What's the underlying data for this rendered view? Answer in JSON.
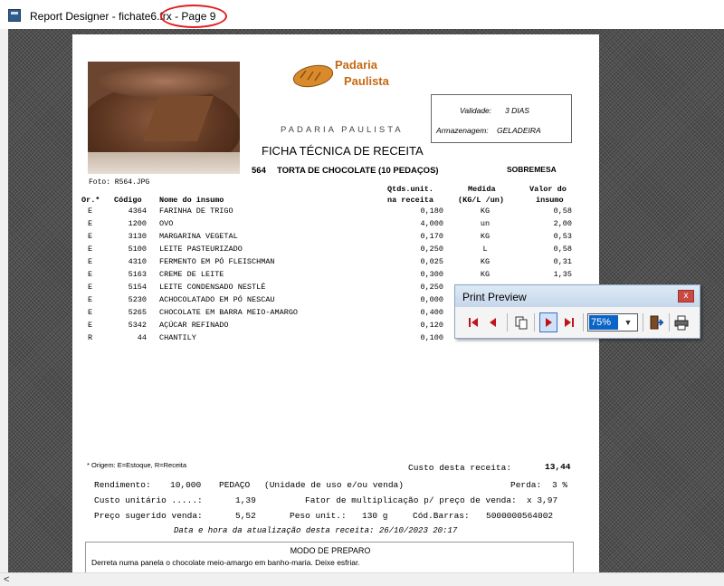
{
  "window": {
    "title": "Report Designer - fichate6.frx",
    "page_label": "- Page 9"
  },
  "report": {
    "header": {
      "logo_line1": "Padaria",
      "logo_line2": "Paulista",
      "subtitle": "PADARIA PAULISTA",
      "title": "FICHA TÉCNICA DE RECEITA",
      "photo_caption": "Foto: R564.JPG",
      "validade_label": "Validade:",
      "validade_value": "3 DIAS",
      "armazenagem_label": "Armazenagem:",
      "armazenagem_value": "GELADEIRA",
      "recipe_code": "564",
      "recipe_name": "TORTA DE CHOCOLATE (10 PEDAÇOS)",
      "category": "SOBREMESA"
    },
    "table": {
      "headers": {
        "or": "Or.*",
        "codigo": "Código",
        "nome": "Nome do insumo",
        "qtd_line1": "Qtds.unit.",
        "qtd_line2": "na receita",
        "medida_line1": "Medida",
        "medida_line2": "(KG/L /un)",
        "valor_line1": "Valor do",
        "valor_line2": "insumo"
      },
      "rows": [
        {
          "or": "E",
          "codigo": "4364",
          "nome": "FARINHA DE TRIGO",
          "qtd": "0,180",
          "medida": "KG",
          "valor": "0,58"
        },
        {
          "or": "E",
          "codigo": "1200",
          "nome": "OVO",
          "qtd": "4,000",
          "medida": "un",
          "valor": "2,00"
        },
        {
          "or": "E",
          "codigo": "3130",
          "nome": "MARGARINA VEGETAL",
          "qtd": "0,170",
          "medida": "KG",
          "valor": "0,53"
        },
        {
          "or": "E",
          "codigo": "5100",
          "nome": "LEITE PASTEURIZADO",
          "qtd": "0,250",
          "medida": "L",
          "valor": "0,58"
        },
        {
          "or": "E",
          "codigo": "4310",
          "nome": "FERMENTO EM PÓ FLEISCHMAN",
          "qtd": "0,025",
          "medida": "KG",
          "valor": "0,31"
        },
        {
          "or": "E",
          "codigo": "5163",
          "nome": "CREME DE LEITE",
          "qtd": "0,300",
          "medida": "KG",
          "valor": "1,35"
        },
        {
          "or": "E",
          "codigo": "5154",
          "nome": "LEITE CONDENSADO NESTLÉ",
          "qtd": "0,250",
          "medida": "",
          "valor": ""
        },
        {
          "or": "E",
          "codigo": "5230",
          "nome": "ACHOCOLATADO EM PÓ NESCAU",
          "qtd": "0,000",
          "medida": "",
          "valor": ""
        },
        {
          "or": "E",
          "codigo": "5265",
          "nome": "CHOCOLATE EM BARRA MEIO-AMARGO",
          "qtd": "0,400",
          "medida": "",
          "valor": ""
        },
        {
          "or": "E",
          "codigo": "5342",
          "nome": "AÇÚCAR REFINADO",
          "qtd": "0,120",
          "medida": "",
          "valor": ""
        },
        {
          "or": "R",
          "codigo": "44",
          "nome": "CHANTILY",
          "qtd": "0,100",
          "medida": "",
          "valor": ""
        }
      ]
    },
    "footer": {
      "origem_note": "* Origem: E=Estoque, R=Receita",
      "custo_receita_label": "Custo desta receita:",
      "custo_receita_value": "13,44",
      "rendimento_label": "Rendimento:",
      "rendimento_value": "10,000",
      "rendimento_unit": "PEDAÇO",
      "rendimento_note": "(Unidade de uso e/ou venda)",
      "perda_label": "Perda:",
      "perda_value": "3 %",
      "custo_unitario_label": "Custo unitário .....:",
      "custo_unitario_value": "1,39",
      "fator_label": "Fator de multiplicação p/ preço de venda:",
      "fator_value": "x 3,97",
      "preco_label": "Preço sugerido venda:",
      "preco_value": "5,52",
      "peso_label": "Peso unit.:",
      "peso_value": "130 g",
      "barras_label": "Cód.Barras:",
      "barras_value": "5000000564002",
      "atualizacao": "Data e hora da atualização desta receita: 26/10/2023 20:17",
      "modo_title": "MODO DE PREPARO",
      "modo_text": "Derreta numa panela o chocolate meio-amargo em banho-maria. Deixe esfriar."
    }
  },
  "print_preview": {
    "title": "Print Preview",
    "close_label": "x",
    "zoom": "75%",
    "buttons": [
      "first-page-icon",
      "prev-page-icon",
      "page-setup-icon",
      "next-page-icon",
      "last-page-icon",
      "exit-icon",
      "print-icon"
    ]
  },
  "colors": {
    "workspace": "#505050",
    "accent_annotation": "#e02020",
    "selection": "#0a64c8",
    "logo": "#c56a10"
  }
}
